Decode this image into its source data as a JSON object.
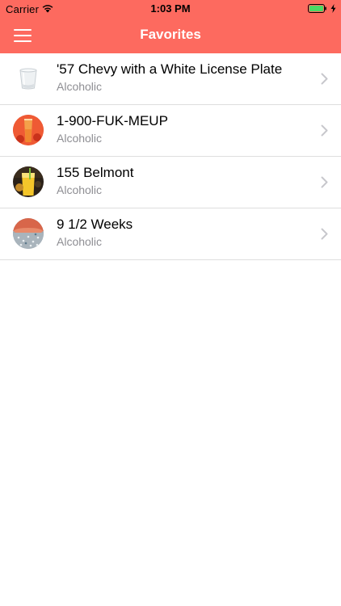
{
  "status_bar": {
    "carrier": "Carrier",
    "time": "1:03 PM",
    "battery_color": "#4cd964"
  },
  "nav": {
    "title": "Favorites",
    "bar_color": "#fd6a5f",
    "menu_icon": "hamburger-menu-icon"
  },
  "favorites": [
    {
      "name": "'57 Chevy with a White License Plate",
      "category": "Alcoholic",
      "icon": "glass-tumbler-icon"
    },
    {
      "name": "1-900-FUK-MEUP",
      "category": "Alcoholic",
      "icon": "red-shot-icon"
    },
    {
      "name": "155 Belmont",
      "category": "Alcoholic",
      "icon": "yellow-drink-icon"
    },
    {
      "name": "9 1/2 Weeks",
      "category": "Alcoholic",
      "icon": "sugar-rim-cocktail-icon"
    }
  ]
}
